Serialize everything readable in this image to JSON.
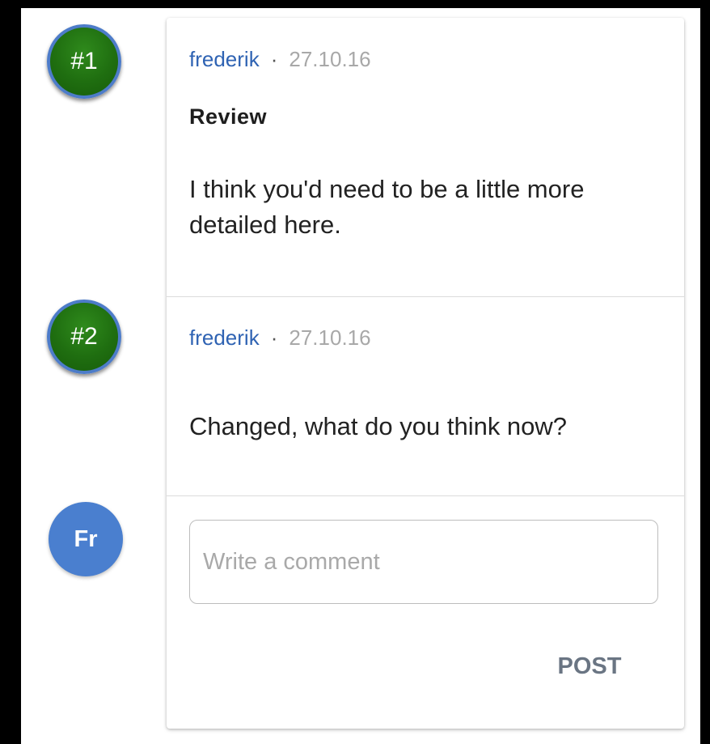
{
  "markers": [
    {
      "label": "#1"
    },
    {
      "label": "#2"
    }
  ],
  "current_user": {
    "initials": "Fr"
  },
  "comments": [
    {
      "author": "frederik",
      "separator": "·",
      "date": "27.10.16",
      "title": "Review",
      "body": "I think you'd need to be a little more detailed here."
    },
    {
      "author": "frederik",
      "separator": "·",
      "date": "27.10.16",
      "body": "Changed, what do you think now?"
    }
  ],
  "composer": {
    "placeholder": "Write a comment",
    "value": "",
    "post_label": "POST"
  },
  "colors": {
    "author": "#2f63b3",
    "date": "#a8a8a8",
    "marker_fill": "#1f6e10",
    "marker_ring": "#4d7cc9",
    "user_avatar": "#4a7fcf",
    "post_button": "#6a7583"
  }
}
